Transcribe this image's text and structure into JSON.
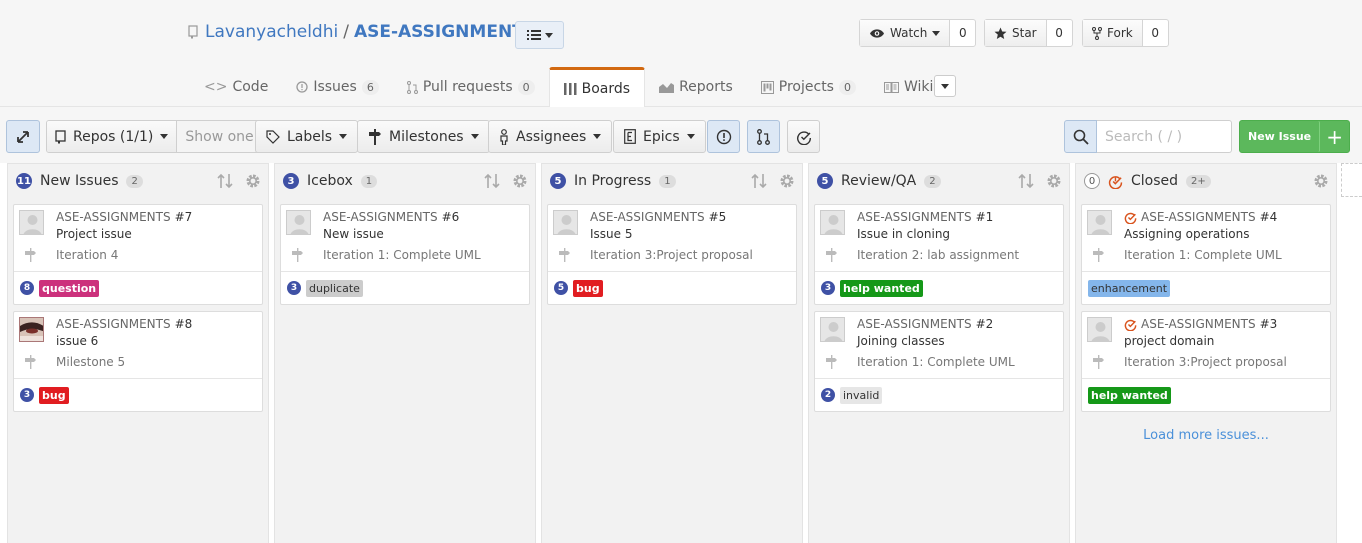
{
  "repo": {
    "owner": "Lavanyacheldhi",
    "separator": "/",
    "name": "ASE-ASSIGNMENTS"
  },
  "social": {
    "watch": {
      "label": "Watch",
      "count": "0"
    },
    "star": {
      "label": "Star",
      "count": "0"
    },
    "fork": {
      "label": "Fork",
      "count": "0"
    }
  },
  "tabs": [
    {
      "label": "Code",
      "count": ""
    },
    {
      "label": "Issues",
      "count": "6"
    },
    {
      "label": "Pull requests",
      "count": "0"
    },
    {
      "label": "Boards",
      "count": ""
    },
    {
      "label": "Reports",
      "count": ""
    },
    {
      "label": "Projects",
      "count": "0"
    },
    {
      "label": "Wiki",
      "count": ""
    }
  ],
  "toolbar": {
    "repos": "Repos (1/1)",
    "show_one": "Show one",
    "labels": "Labels",
    "milestones": "Milestones",
    "assignees": "Assignees",
    "epics": "Epics",
    "search_placeholder": "Search ( / )",
    "new_issue": "New Issue",
    "plus": "+"
  },
  "colors": {
    "accent": "#3f51a5",
    "green": "#5cb85c",
    "closed": "#d9541e"
  },
  "columns": [
    {
      "number": "11",
      "title": "New Issues",
      "count": "2",
      "cards": [
        {
          "repo": "ASE-ASSIGNMENTS",
          "num": "#7",
          "title": "Project issue",
          "milestone": "Iteration 4",
          "points": "8",
          "label": "question",
          "label_color": "#cc317c",
          "closed": false,
          "avatar": "default"
        },
        {
          "repo": "ASE-ASSIGNMENTS",
          "num": "#8",
          "title": "issue 6",
          "milestone": "Milestone 5",
          "points": "3",
          "label": "bug",
          "label_color": "#e11d21",
          "closed": false,
          "avatar": "photo"
        }
      ]
    },
    {
      "number": "3",
      "title": "Icebox",
      "count": "1",
      "cards": [
        {
          "repo": "ASE-ASSIGNMENTS",
          "num": "#6",
          "title": "New issue",
          "milestone": "Iteration 1: Complete UML",
          "points": "3",
          "label": "duplicate",
          "label_color": "#cccccc",
          "closed": false,
          "avatar": "default"
        }
      ]
    },
    {
      "number": "5",
      "title": "In Progress",
      "count": "1",
      "cards": [
        {
          "repo": "ASE-ASSIGNMENTS",
          "num": "#5",
          "title": "Issue 5",
          "milestone": "Iteration 3:Project proposal",
          "points": "5",
          "label": "bug",
          "label_color": "#e11d21",
          "closed": false,
          "avatar": "default"
        }
      ]
    },
    {
      "number": "5",
      "title": "Review/QA",
      "count": "2",
      "cards": [
        {
          "repo": "ASE-ASSIGNMENTS",
          "num": "#1",
          "title": "Issue in cloning",
          "milestone": "Iteration 2: lab assignment",
          "points": "3",
          "label": "help wanted",
          "label_color": "#159818",
          "closed": false,
          "avatar": "default"
        },
        {
          "repo": "ASE-ASSIGNMENTS",
          "num": "#2",
          "title": "Joining classes",
          "milestone": "Iteration 1: Complete UML",
          "points": "2",
          "label": "invalid",
          "label_color": "#e6e6e6",
          "closed": false,
          "avatar": "default"
        }
      ]
    },
    {
      "number": "0",
      "title": "Closed",
      "count": "2+",
      "cards": [
        {
          "repo": "ASE-ASSIGNMENTS",
          "num": "#4",
          "title": "Assigning operations",
          "milestone": "Iteration 1: Complete UML",
          "points": "",
          "label": "enhancement",
          "label_color": "#84b6eb",
          "closed": true,
          "avatar": "default"
        },
        {
          "repo": "ASE-ASSIGNMENTS",
          "num": "#3",
          "title": "project domain",
          "milestone": "Iteration 3:Project proposal",
          "points": "",
          "label": "help wanted",
          "label_color": "#159818",
          "closed": true,
          "avatar": "default"
        }
      ],
      "load_more": "Load more issues..."
    }
  ]
}
